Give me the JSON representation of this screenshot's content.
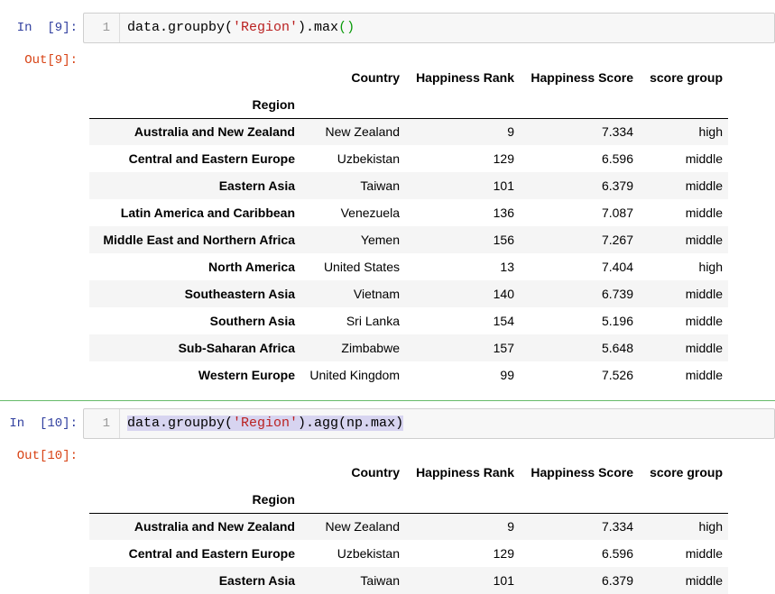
{
  "cells": [
    {
      "in_prompt": "In  [9]:",
      "line_number": "1",
      "code": {
        "pre": "data.groupby(",
        "str": "'Region'",
        "post": ").max",
        "paren": "()"
      },
      "out_prompt": "Out[9]:",
      "columns": [
        "Country",
        "Happiness Rank",
        "Happiness Score",
        "score group"
      ],
      "index_name": "Region",
      "rows": [
        {
          "region": "Australia and New Zealand",
          "country": "New Zealand",
          "rank": "9",
          "score": "7.334",
          "group": "high"
        },
        {
          "region": "Central and Eastern Europe",
          "country": "Uzbekistan",
          "rank": "129",
          "score": "6.596",
          "group": "middle"
        },
        {
          "region": "Eastern Asia",
          "country": "Taiwan",
          "rank": "101",
          "score": "6.379",
          "group": "middle"
        },
        {
          "region": "Latin America and Caribbean",
          "country": "Venezuela",
          "rank": "136",
          "score": "7.087",
          "group": "middle"
        },
        {
          "region": "Middle East and Northern Africa",
          "country": "Yemen",
          "rank": "156",
          "score": "7.267",
          "group": "middle"
        },
        {
          "region": "North America",
          "country": "United States",
          "rank": "13",
          "score": "7.404",
          "group": "high"
        },
        {
          "region": "Southeastern Asia",
          "country": "Vietnam",
          "rank": "140",
          "score": "6.739",
          "group": "middle"
        },
        {
          "region": "Southern Asia",
          "country": "Sri Lanka",
          "rank": "154",
          "score": "5.196",
          "group": "middle"
        },
        {
          "region": "Sub-Saharan Africa",
          "country": "Zimbabwe",
          "rank": "157",
          "score": "5.648",
          "group": "middle"
        },
        {
          "region": "Western Europe",
          "country": "United Kingdom",
          "rank": "99",
          "score": "7.526",
          "group": "middle"
        }
      ]
    },
    {
      "in_prompt": "In  [10]:",
      "line_number": "1",
      "code": {
        "pre": "data.groupby(",
        "str": "'Region'",
        "post": ").agg(np.max)"
      },
      "out_prompt": "Out[10]:",
      "columns": [
        "Country",
        "Happiness Rank",
        "Happiness Score",
        "score group"
      ],
      "index_name": "Region",
      "rows": [
        {
          "region": "Australia and New Zealand",
          "country": "New Zealand",
          "rank": "9",
          "score": "7.334",
          "group": "high"
        },
        {
          "region": "Central and Eastern Europe",
          "country": "Uzbekistan",
          "rank": "129",
          "score": "6.596",
          "group": "middle"
        },
        {
          "region": "Eastern Asia",
          "country": "Taiwan",
          "rank": "101",
          "score": "6.379",
          "group": "middle"
        }
      ]
    }
  ]
}
